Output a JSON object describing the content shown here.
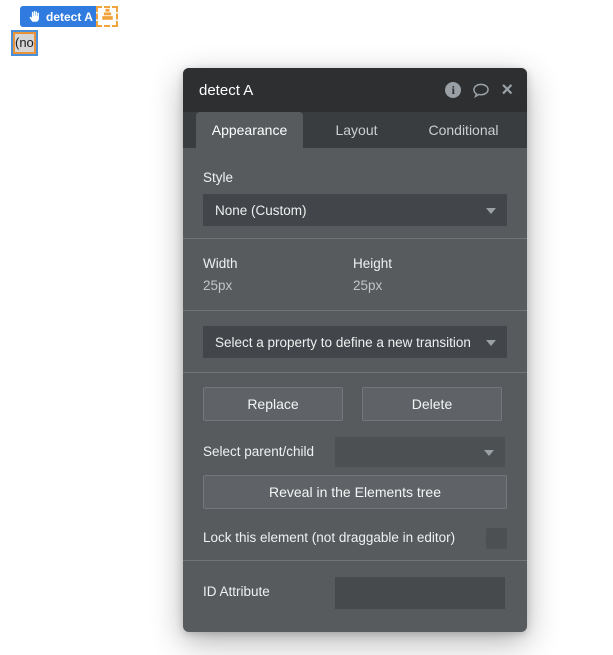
{
  "canvas": {
    "badge_label": "detect A",
    "element_text": "(no"
  },
  "panel": {
    "title": "detect A",
    "header_icons": {
      "info_glyph": "i",
      "close_glyph": "×"
    },
    "tabs": [
      {
        "label": "Appearance",
        "active": true
      },
      {
        "label": "Layout",
        "active": false
      },
      {
        "label": "Conditional",
        "active": false
      }
    ],
    "style": {
      "label": "Style",
      "value": "None (Custom)"
    },
    "size": {
      "width_label": "Width",
      "width_value": "25px",
      "height_label": "Height",
      "height_value": "25px"
    },
    "transition": {
      "placeholder": "Select a property to define a new transition"
    },
    "actions": {
      "replace": "Replace",
      "delete": "Delete"
    },
    "parent_child": {
      "label": "Select parent/child",
      "value": ""
    },
    "reveal": {
      "label": "Reveal in the Elements tree"
    },
    "lock": {
      "label": "Lock this element (not draggable in editor)",
      "checked": false
    },
    "id_attribute": {
      "label": "ID Attribute",
      "value": ""
    }
  },
  "colors": {
    "badge_blue": "#2f7be0",
    "accent_orange": "#f0a33c",
    "selection_blue": "#4a90d9",
    "panel_body": "#575b5e",
    "panel_header": "#2d2f30",
    "tab_bar": "#3a3d3f",
    "input_bg": "#42464a",
    "button_bg": "#5f6367"
  }
}
